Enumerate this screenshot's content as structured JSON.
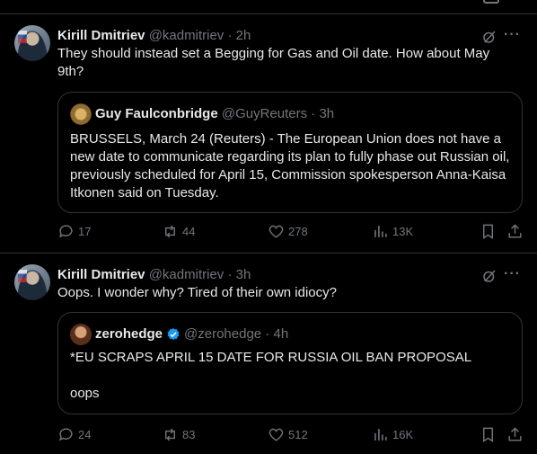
{
  "tweets": [
    {
      "author_name": "Kirill Dmitriev",
      "handle": "@kadmitriev",
      "time": "2h",
      "text": "They should instead set a Begging for Gas and Oil date. How about May 9th?",
      "quote": {
        "author_name": "Guy Faulconbridge",
        "handle": "@GuyReuters",
        "time": "3h",
        "verified": false,
        "text": "BRUSSELS, March 24 (Reuters) - The European Union does not have a new date to communicate regarding its plan to fully phase out Russian oil, previously scheduled for April 15, Commission spokesperson Anna-Kaisa Itkonen said on Tuesday.",
        "text2": ""
      },
      "replies": "17",
      "reposts": "44",
      "likes": "278",
      "views": "13K"
    },
    {
      "author_name": "Kirill Dmitriev",
      "handle": "@kadmitriev",
      "time": "3h",
      "text": "Oops. I wonder why? Tired of their own idiocy?",
      "quote": {
        "author_name": "zerohedge",
        "handle": "@zerohedge",
        "time": "4h",
        "verified": true,
        "text": "*EU SCRAPS APRIL 15 DATE FOR RUSSIA OIL BAN PROPOSAL",
        "text2": "oops"
      },
      "replies": "24",
      "reposts": "83",
      "likes": "512",
      "views": "16K"
    }
  ],
  "separator": "·",
  "more_label": "···",
  "colors": {
    "text": "#e7e9ea",
    "muted": "#71767b",
    "border": "#2f3336",
    "verified": "#1d9bf0"
  }
}
